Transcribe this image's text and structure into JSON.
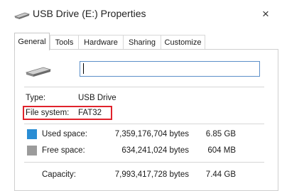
{
  "window": {
    "title": "USB Drive (E:) Properties",
    "close_glyph": "×"
  },
  "tabs": [
    {
      "label": "General",
      "active": true
    },
    {
      "label": "Tools"
    },
    {
      "label": "Hardware"
    },
    {
      "label": "Sharing"
    },
    {
      "label": "Customize"
    }
  ],
  "name_field": {
    "value": ""
  },
  "info": {
    "type_label": "Type:",
    "type_value": "USB Drive",
    "fs_label": "File system:",
    "fs_value": "FAT32"
  },
  "usage": {
    "used_label": "Used space:",
    "used_bytes": "7,359,176,704 bytes",
    "used_size": "6.85 GB",
    "used_color": "#2a8dd4",
    "free_label": "Free space:",
    "free_bytes": "634,241,024 bytes",
    "free_size": "604 MB",
    "free_color": "#9b9b9b",
    "capacity_label": "Capacity:",
    "capacity_bytes": "7,993,417,728 bytes",
    "capacity_size": "7.44 GB"
  },
  "icons": {
    "title_icon": "usb-drive-icon",
    "large_icon": "usb-drive-icon"
  }
}
